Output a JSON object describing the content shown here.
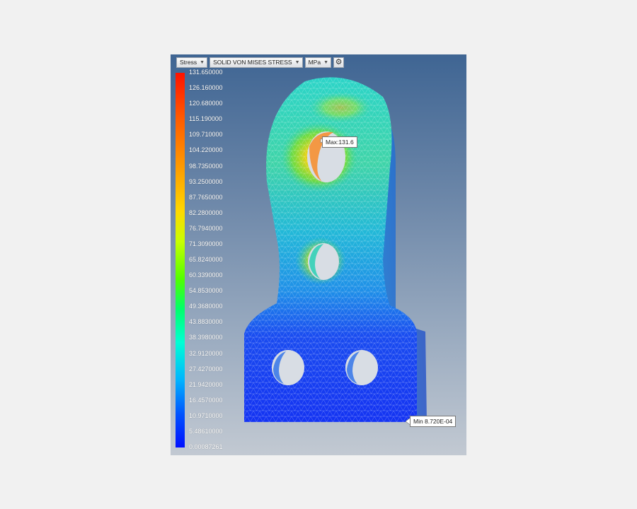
{
  "toolbar": {
    "result_type": "Stress",
    "component": "SOLID VON MISES STRESS",
    "unit": "MPa",
    "settings_icon": "gear-icon"
  },
  "legend": {
    "values": [
      "131.650000",
      "126.160000",
      "120.680000",
      "115.190000",
      "109.710000",
      "104.220000",
      "98.7350000",
      "93.2500000",
      "87.7650000",
      "82.2800000",
      "76.7940000",
      "71.3090000",
      "65.8240000",
      "60.3390000",
      "54.8530000",
      "49.3680000",
      "43.8830000",
      "38.3980000",
      "32.9120000",
      "27.4270000",
      "21.9420000",
      "16.4570000",
      "10.9710000",
      "5.48610000",
      "0.00087261"
    ]
  },
  "callouts": {
    "max": "Max:131.6",
    "min": "Min 8.720E-04"
  },
  "colors": {
    "max": "#ff1200",
    "min": "#0010ff",
    "background_top": "#3f6593",
    "background_bottom": "#c2c9d2"
  }
}
